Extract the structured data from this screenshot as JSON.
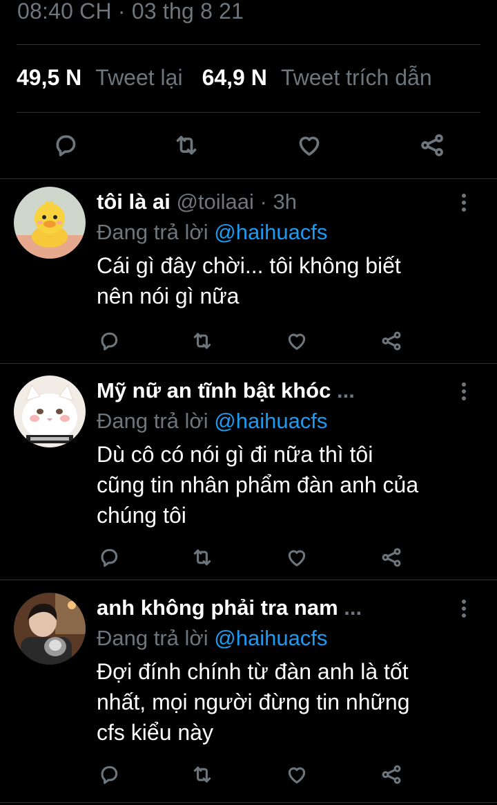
{
  "tweet": {
    "timestamp": "08:40 CH · 03 thg 8 21",
    "stats": {
      "retweets_count": "49,5 N",
      "retweets_label": "Tweet lại",
      "quotes_count": "64,9 N",
      "quotes_label": "Tweet trích dẫn"
    },
    "actions": [
      "reply-icon",
      "retweet-icon",
      "like-icon",
      "share-icon"
    ]
  },
  "replies": [
    {
      "name": "tôi là ai",
      "name_truncated": false,
      "handle": "@toilaai",
      "separator": "·",
      "time": "3h",
      "replying_prefix": "Đang trả lời",
      "replying_to": "@haihuacfs",
      "text_lines": [
        "Cái gì đây chời... tôi không biết",
        "nên nói gì nữa"
      ],
      "avatar": "yellow-duck-avatar"
    },
    {
      "name": "Mỹ nữ an tĩnh bật khóc",
      "name_truncated": true,
      "ellipsis": "...",
      "replying_prefix": "Đang trả lời",
      "replying_to": "@haihuacfs",
      "text_lines": [
        "Dù cô có nói gì đi nữa thì tôi",
        "cũng tin nhân phẩm đàn anh của",
        "chúng tôi"
      ],
      "avatar": "white-cat-avatar"
    },
    {
      "name": "anh không phải tra nam",
      "name_truncated": true,
      "ellipsis": "...",
      "replying_prefix": "Đang trả lời",
      "replying_to": "@haihuacfs",
      "text_lines": [
        "Đợi đính chính từ đàn anh là tốt",
        "nhất, mọi người đừng tin những",
        "cfs kiểu này"
      ],
      "avatar": "person-with-cat-avatar"
    }
  ],
  "colors": {
    "background": "#000000",
    "primary_text": "#ffffff",
    "secondary_text": "#6e767d",
    "link": "#1d9bf0",
    "divider": "#2f3336"
  }
}
